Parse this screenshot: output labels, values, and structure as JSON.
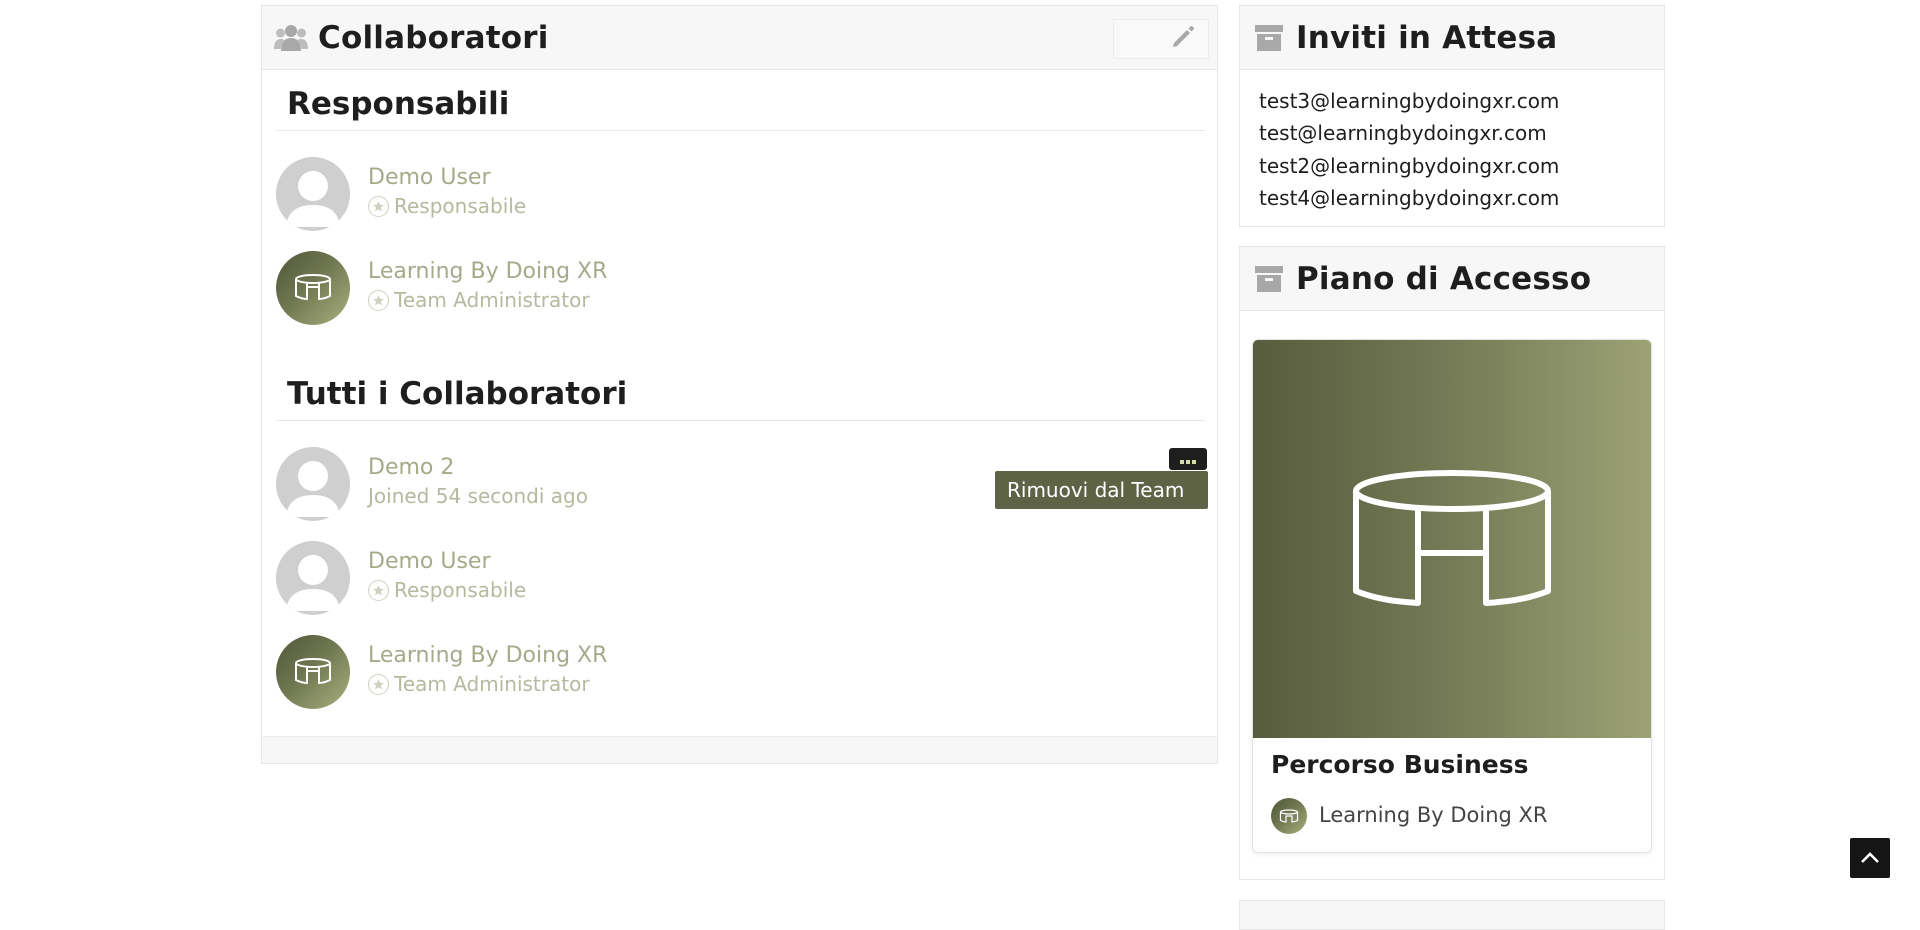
{
  "collaborators": {
    "title": "Collaboratori",
    "icons": {
      "header": "users-icon",
      "edit": "pencil-icon"
    },
    "managers_section": {
      "title": "Responsabili",
      "members": [
        {
          "name": "Demo User",
          "role": "Responsabile",
          "avatar": "default-avatar"
        },
        {
          "name": "Learning By Doing XR",
          "role": "Team Administrator",
          "avatar": "brand-logo-avatar"
        }
      ]
    },
    "all_section": {
      "title": "Tutti i Collaboratori",
      "members": [
        {
          "name": "Demo 2",
          "role": "Joined 54 secondi ago",
          "avatar": "default-avatar"
        },
        {
          "name": "Demo User",
          "role": "Responsabile",
          "avatar": "default-avatar"
        },
        {
          "name": "Learning By Doing XR",
          "role": "Team Administrator",
          "avatar": "brand-logo-avatar"
        }
      ]
    },
    "member_menu": {
      "trigger_icon": "ellipsis-icon",
      "remove_label": "Rimuovi dal Team"
    }
  },
  "invites": {
    "title": "Inviti in Attesa",
    "icon": "archive-icon",
    "emails": [
      "test3@learningbydoingxr.com",
      "test@learningbydoingxr.com",
      "test2@learningbydoingxr.com",
      "test4@learningbydoingxr.com"
    ]
  },
  "access_plan": {
    "title": "Piano di Accesso",
    "icon": "archive-icon",
    "card": {
      "title": "Percorso Business",
      "owner": "Learning By Doing XR",
      "cover_icon": "brand-logo-icon"
    }
  },
  "scroll_top": {
    "icon": "chevron-up-icon"
  },
  "colors": {
    "accent": "#5f6346",
    "muted_text": "#a6a98a",
    "dark": "#1e1e1e",
    "panel_header": "#f7f7f7"
  }
}
